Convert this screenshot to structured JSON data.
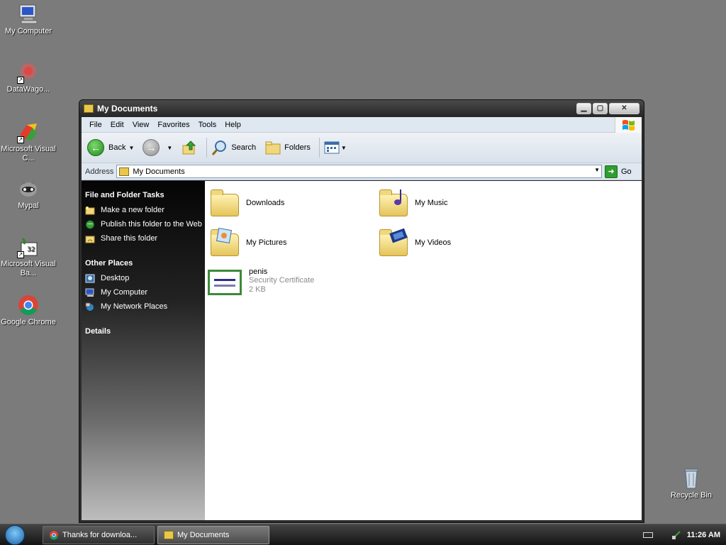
{
  "desktop": {
    "icons": [
      {
        "label": "My Computer"
      },
      {
        "label": "DataWago..."
      },
      {
        "label": "Microsoft Visual C..."
      },
      {
        "label": "Mypal"
      },
      {
        "label": "Microsoft Visual Ba..."
      },
      {
        "label": "Google Chrome"
      },
      {
        "label": "Recycle Bin"
      }
    ]
  },
  "window": {
    "title": "My Documents",
    "menu": [
      "File",
      "Edit",
      "View",
      "Favorites",
      "Tools",
      "Help"
    ],
    "toolbar": {
      "back_label": "Back",
      "search_label": "Search",
      "folders_label": "Folders"
    },
    "address": {
      "label": "Address",
      "value": "My Documents",
      "go_label": "Go"
    },
    "taskpane": {
      "file_tasks_title": "File and Folder Tasks",
      "file_tasks": [
        {
          "label": "Make a new folder"
        },
        {
          "label": "Publish this folder to the Web"
        },
        {
          "label": "Share this folder"
        }
      ],
      "other_places_title": "Other Places",
      "other_places": [
        {
          "label": "Desktop"
        },
        {
          "label": "My Computer"
        },
        {
          "label": "My Network Places"
        }
      ],
      "details_title": "Details"
    },
    "files": [
      {
        "name": "Downloads"
      },
      {
        "name": "My Music"
      },
      {
        "name": "My Pictures"
      },
      {
        "name": "My Videos"
      },
      {
        "name": "penis",
        "type": "Security Certificate",
        "size": "2 KB"
      }
    ]
  },
  "taskbar": {
    "buttons": [
      {
        "label": "Thanks for downloa..."
      },
      {
        "label": "My Documents"
      }
    ],
    "clock": "11:26 AM"
  }
}
